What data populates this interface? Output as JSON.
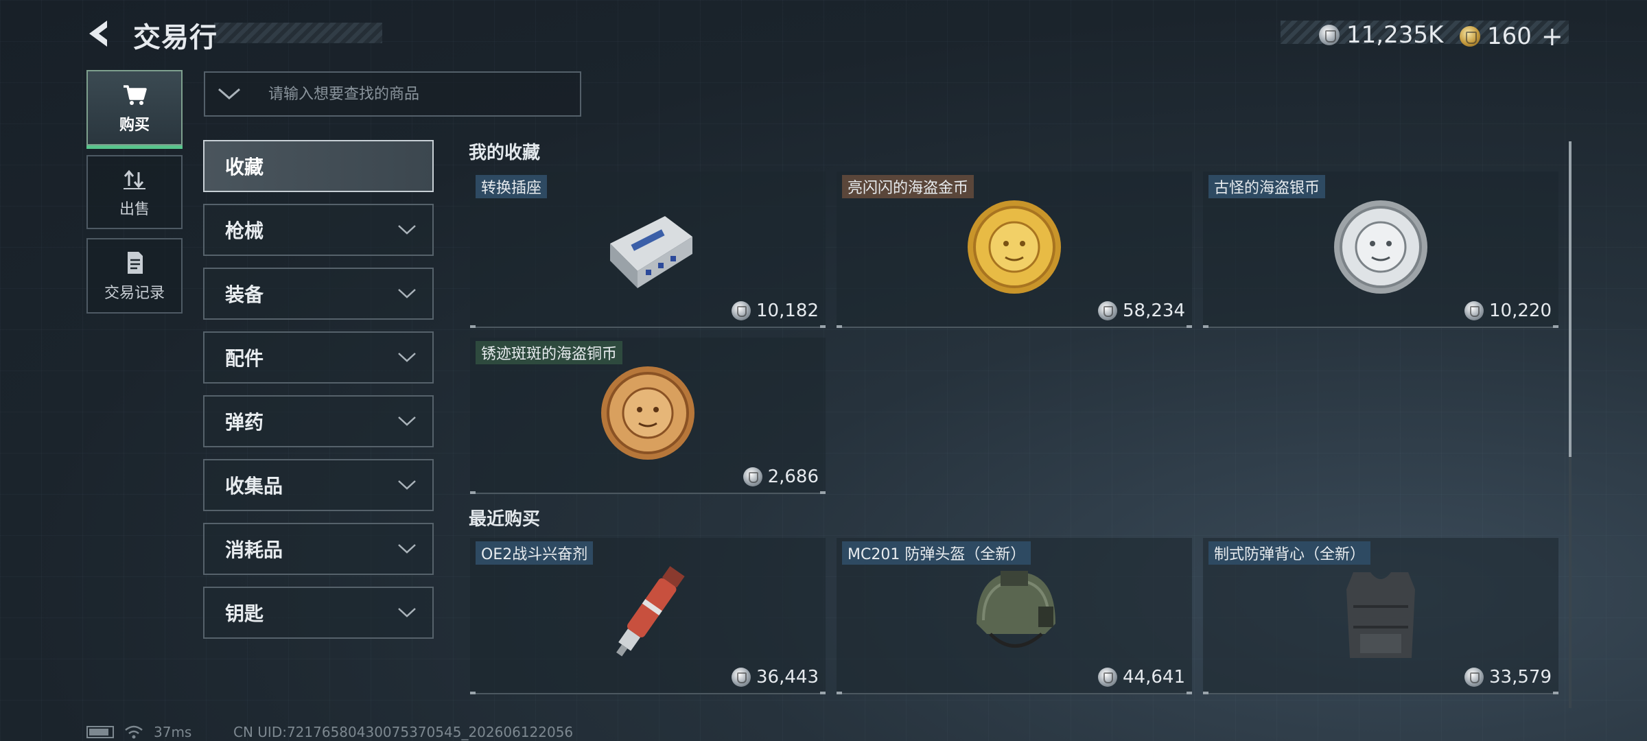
{
  "header": {
    "title": "交易行",
    "currency_primary": "11,235K",
    "currency_secondary": "160",
    "currency_secondary_suffix": "+"
  },
  "nav": {
    "items": [
      {
        "label": "购买",
        "icon": "cart-icon",
        "active": true
      },
      {
        "label": "出售",
        "icon": "sell-arrows-icon",
        "active": false
      },
      {
        "label": "交易记录",
        "icon": "document-icon",
        "active": false
      }
    ]
  },
  "search": {
    "placeholder": "请输入想要查找的商品"
  },
  "categories": [
    {
      "label": "收藏",
      "active": true
    },
    {
      "label": "枪械"
    },
    {
      "label": "装备"
    },
    {
      "label": "配件"
    },
    {
      "label": "弹药"
    },
    {
      "label": "收集品"
    },
    {
      "label": "消耗品"
    },
    {
      "label": "钥匙"
    }
  ],
  "sections": {
    "favorites_title": "我的收藏",
    "recent_title": "最近购买"
  },
  "favorites": [
    {
      "name": "转换插座",
      "price": "10,182",
      "tag_color": "blue",
      "icon": "adapter-socket-icon"
    },
    {
      "name": "亮闪闪的海盗金币",
      "price": "58,234",
      "tag_color": "brown",
      "icon": "gold-pirate-coin-icon"
    },
    {
      "name": "古怪的海盗银币",
      "price": "10,220",
      "tag_color": "blue",
      "icon": "silver-pirate-coin-icon"
    },
    {
      "name": "锈迹斑斑的海盗铜币",
      "price": "2,686",
      "tag_color": "green",
      "icon": "copper-pirate-coin-icon"
    }
  ],
  "recent": [
    {
      "name": "OE2战斗兴奋剂",
      "price": "36,443",
      "tag_color": "blue",
      "icon": "stimulant-injector-icon"
    },
    {
      "name": "MC201 防弹头盔（全新）",
      "price": "44,641",
      "tag_color": "blue",
      "icon": "helmet-icon"
    },
    {
      "name": "制式防弹背心（全新）",
      "price": "33,579",
      "tag_color": "blue",
      "icon": "body-armor-icon"
    }
  ],
  "footer": {
    "ping": "37ms",
    "uid": "CN UID:72176580430075370545_202606122056"
  },
  "colors": {
    "accent_green": "#58c58c",
    "tag_blue": "#2e4a62",
    "tag_brown": "#5a463a",
    "tag_green": "#2e4a3e"
  }
}
